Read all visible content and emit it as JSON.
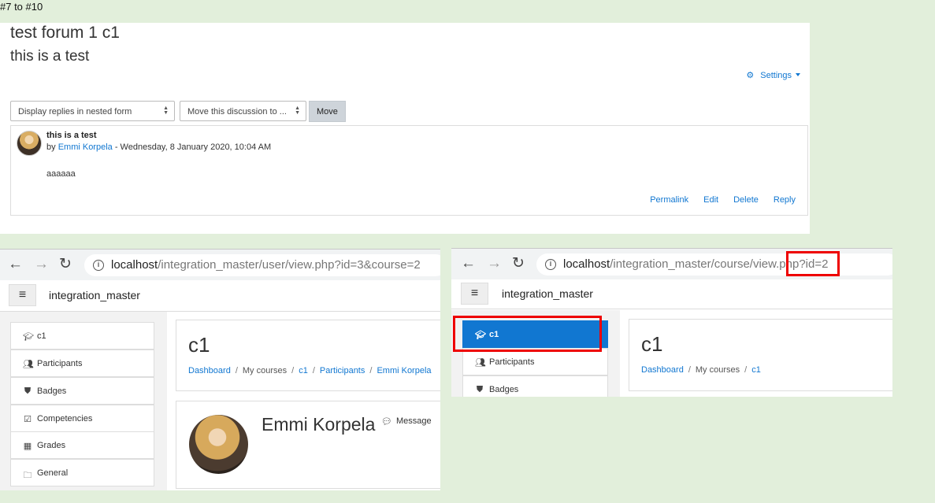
{
  "caption": "#7 to #10",
  "forum": {
    "title": "test forum 1 c1",
    "subtitle": "this is a test",
    "settings_label": "Settings",
    "display_select": "Display replies in nested form",
    "move_select": "Move this discussion to ...",
    "move_button": "Move",
    "post": {
      "subject": "this is a test",
      "by_prefix": "by ",
      "author": "Emmi Korpela",
      "date": " - Wednesday, 8 January 2020, 10:04 AM",
      "body": "aaaaaa",
      "links": [
        "Permalink",
        "Edit",
        "Delete",
        "Reply"
      ]
    }
  },
  "user_view": {
    "url_host": "localhost",
    "url_path": "/integration_master/user/view.php?id=3&course=2",
    "site_name": "integration_master",
    "nav": [
      {
        "icon": "graduation-cap-icon",
        "label": "c1"
      },
      {
        "icon": "users-icon",
        "label": "Participants"
      },
      {
        "icon": "shield-icon",
        "label": "Badges"
      },
      {
        "icon": "check-square-icon",
        "label": "Competencies"
      },
      {
        "icon": "table-icon",
        "label": "Grades"
      },
      {
        "icon": "folder-icon",
        "label": "General"
      }
    ],
    "course_title": "c1",
    "breadcrumb": [
      "Dashboard",
      "My courses",
      "c1",
      "Participants",
      "Emmi Korpela"
    ],
    "profile_name": "Emmi Korpela",
    "message_label": "Message"
  },
  "course_view": {
    "url_host": "localhost",
    "url_path": "/integration_master/course/view.php?id=2",
    "site_name": "integration_master",
    "nav": [
      {
        "icon": "graduation-cap-icon",
        "label": "c1"
      },
      {
        "icon": "users-icon",
        "label": "Participants"
      },
      {
        "icon": "shield-icon",
        "label": "Badges"
      }
    ],
    "course_title": "c1",
    "breadcrumb": [
      "Dashboard",
      "My courses",
      "c1"
    ]
  },
  "colors": {
    "link": "#1177d1",
    "active_nav": "#1177d1",
    "highlight": "#e00000",
    "page_bg": "#e2efdb"
  }
}
